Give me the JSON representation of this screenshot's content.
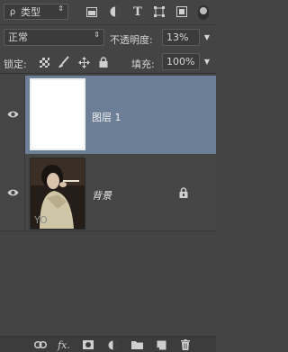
{
  "filter": {
    "search_glyph": "ρ",
    "kind_label": "类型",
    "arrow": "⇕"
  },
  "blend_mode": {
    "value": "正常",
    "arrow": "⇕"
  },
  "opacity": {
    "label": "不透明度:",
    "value": "13%",
    "arrow": "▼"
  },
  "lock": {
    "label": "锁定:"
  },
  "fill": {
    "label": "填充:",
    "value": "100%",
    "arrow": "▼"
  },
  "layers": [
    {
      "name": "图层 1",
      "thumbnail": "white",
      "selected": true,
      "locked": false
    },
    {
      "name": "背景",
      "thumbnail": "photo",
      "selected": false,
      "locked": true
    }
  ],
  "photo_watermark": "YO",
  "footer_fx": "fx.",
  "colors": {
    "panel": "#444444",
    "selected": "#6c7f97",
    "input_bg": "#3b3b3b",
    "text": "#d6d6d6"
  },
  "icons": {
    "filter_icons": [
      "image-filter-icon",
      "adjustment-filter-icon",
      "type-filter-icon",
      "shape-filter-icon",
      "smart-object-filter-icon"
    ],
    "lock_icons": [
      "lock-transparent-pixels-icon",
      "lock-image-pixels-icon",
      "lock-position-icon",
      "lock-all-icon"
    ],
    "footer_icons": [
      "link-layers-icon",
      "fx-icon",
      "add-mask-icon",
      "adjustment-layer-icon",
      "new-group-icon",
      "new-layer-icon",
      "delete-layer-icon"
    ]
  }
}
